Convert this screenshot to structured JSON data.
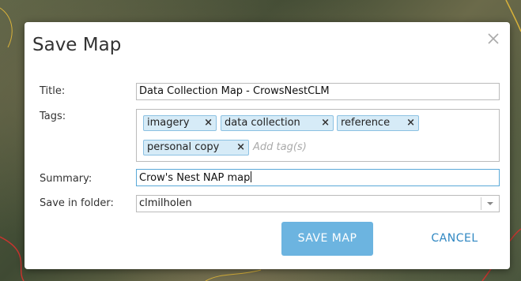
{
  "dialog": {
    "title": "Save Map",
    "close_icon": "close-icon"
  },
  "form": {
    "title_label": "Title:",
    "title_value": "Data Collection Map - CrowsNestCLM",
    "tags_label": "Tags:",
    "tags": [
      {
        "label": "imagery"
      },
      {
        "label": "data collection"
      },
      {
        "label": "reference"
      },
      {
        "label": "personal copy"
      }
    ],
    "tag_remove_glyph": "×",
    "tag_placeholder": "Add tag(s)",
    "summary_label": "Summary:",
    "summary_value": "Crow's Nest NAP map",
    "folder_label": "Save in folder:",
    "folder_value": "clmilholen"
  },
  "buttons": {
    "save": "SAVE MAP",
    "cancel": "CANCEL"
  },
  "colors": {
    "accent": "#6cb4e0",
    "link": "#2f87c2",
    "tag_bg": "#d6ebf7",
    "tag_border": "#8cc1e2"
  }
}
